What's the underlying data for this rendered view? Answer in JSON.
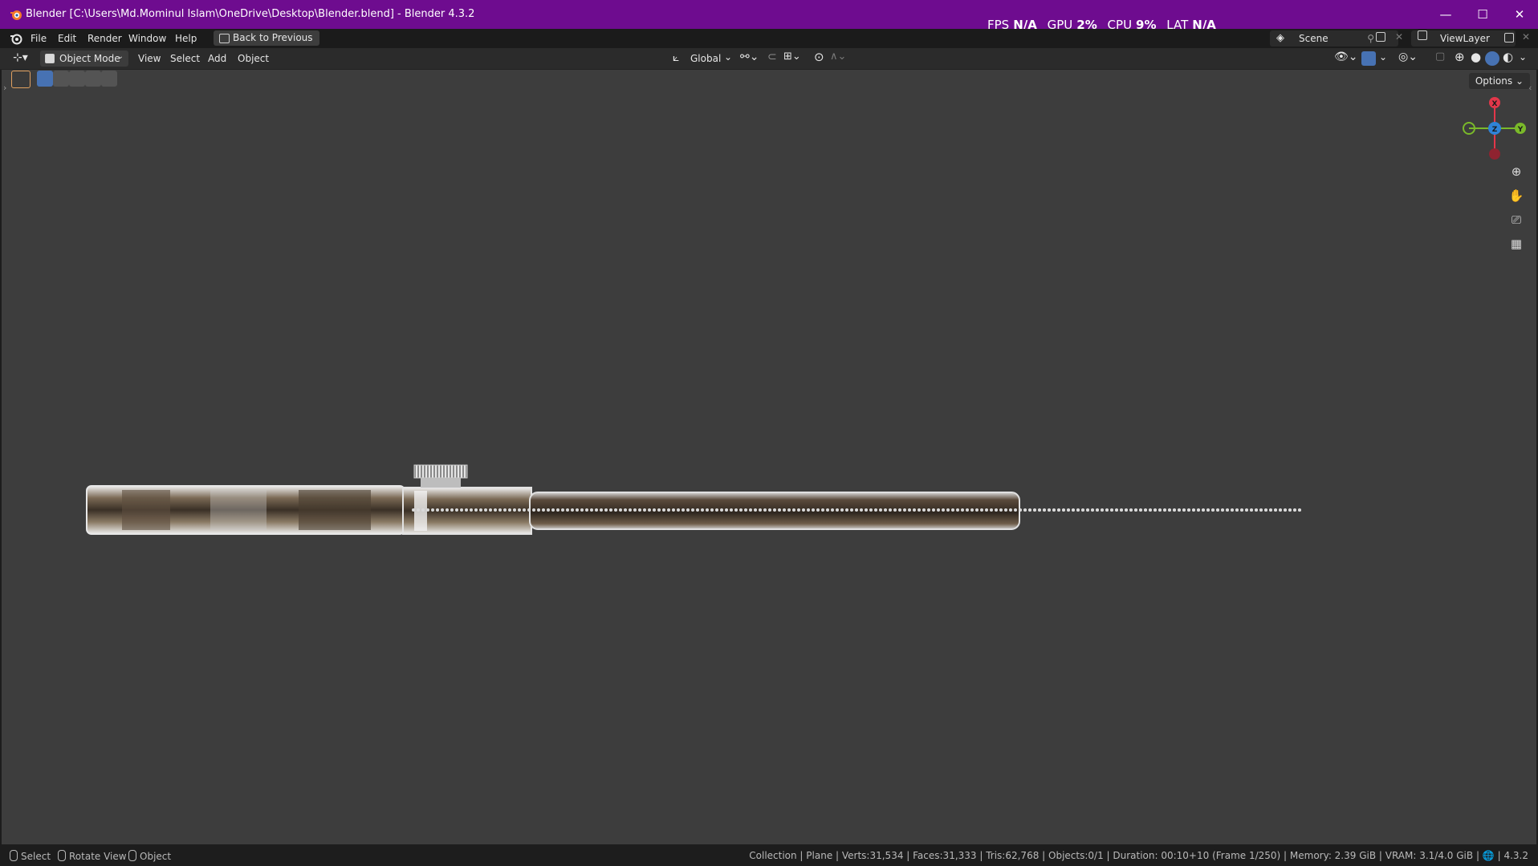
{
  "window": {
    "title": "Blender [C:\\Users\\Md.Mominul Islam\\OneDrive\\Desktop\\Blender.blend] - Blender 4.3.2",
    "controls": {
      "minimize": "—",
      "maximize": "☐",
      "close": "✕"
    }
  },
  "stats": {
    "fps_label": "FPS",
    "fps_value": "N/A",
    "gpu_label": "GPU",
    "gpu_value": "2%",
    "cpu_label": "CPU",
    "cpu_value": "9%",
    "lat_label": "LAT",
    "lat_value": "N/A"
  },
  "menu": {
    "items": [
      "File",
      "Edit",
      "Render",
      "Window",
      "Help"
    ],
    "back_button": "Back to Previous",
    "scene": "Scene",
    "view_layer": "ViewLayer"
  },
  "header": {
    "mode": "Object Mode",
    "menus": [
      "View",
      "Select",
      "Add",
      "Object"
    ],
    "transform_orientation": "Global"
  },
  "viewport": {
    "options_label": "Options",
    "gizmo": {
      "x": "X",
      "y": "Y",
      "z": "Z"
    },
    "background_color": "#3d3d3d"
  },
  "statusbar": {
    "hints": [
      "Select",
      "Rotate View",
      "Object"
    ],
    "info": "Collection | Plane | Verts:31,534 | Faces:31,333 | Tris:62,768 | Objects:0/1 | Duration: 00:10+10 (Frame 1/250) | Memory: 2.39 GiB | VRAM: 3.1/4.0 GiB",
    "version": "4.3.2"
  },
  "colors": {
    "titlebar": "#6e0c8f",
    "axis_x": "#e3374a",
    "axis_y": "#7ab92a",
    "axis_z": "#2f83d6"
  }
}
